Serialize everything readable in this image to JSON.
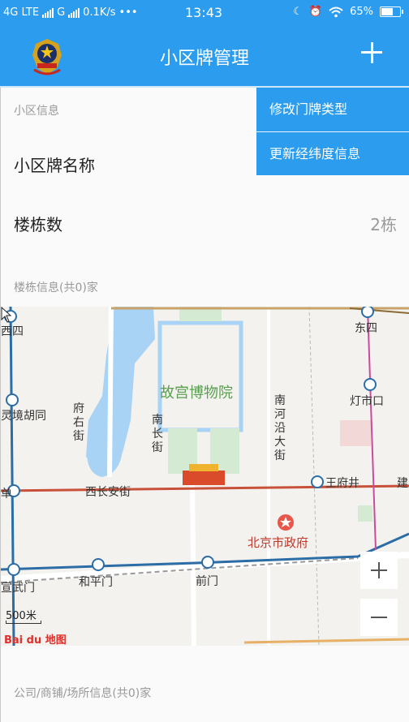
{
  "status_bar": {
    "network": "4G LTE",
    "network2": "G",
    "speed": "0.1K/s",
    "dots": "•••",
    "time": "13:43",
    "battery": "65%"
  },
  "header": {
    "title": "小区牌管理",
    "emblem_icon": "police-emblem-icon",
    "add_icon": "plus-icon"
  },
  "menu": {
    "items": [
      {
        "label": "修改门牌类型"
      },
      {
        "label": "更新经纬度信息"
      }
    ]
  },
  "community": {
    "section_label": "小区信息",
    "name_label": "小区牌名称",
    "building_count_label": "楼栋数",
    "building_count_value": "2栋"
  },
  "buildings": {
    "section_label": "楼栋信息(共0)家"
  },
  "map": {
    "labels": {
      "palace": "故宫博物院",
      "xisi": "西四",
      "dongsi": "东四",
      "xuanwumen": "宣武门",
      "hepingmen": "和平门",
      "qianmen": "前门",
      "wangfujing": "王府井",
      "dengshikou": "灯市口",
      "xichangan": "西长安街",
      "lingjing": "灵境胡同",
      "fuyoujie": "府右街",
      "nanchangjie": "南长街",
      "nanheyan": "南河沿大街",
      "gov": "北京市政府",
      "jian": "建",
      "dan": "单"
    },
    "scale": "500米",
    "logo": "Bai du 地图"
  },
  "businesses": {
    "section_label": "公司/商铺/场所信息(共0)家"
  }
}
